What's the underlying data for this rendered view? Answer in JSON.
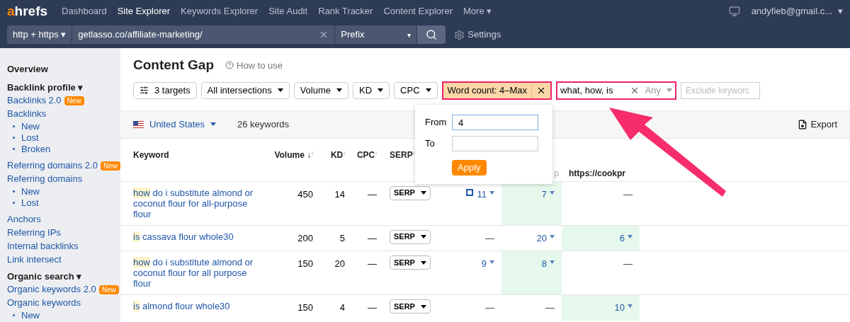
{
  "nav": {
    "logo": "ahrefs",
    "items": [
      {
        "label": "Dashboard",
        "selected": false
      },
      {
        "label": "Site Explorer",
        "selected": true
      },
      {
        "label": "Keywords Explorer",
        "selected": false
      },
      {
        "label": "Site Audit",
        "selected": false
      },
      {
        "label": "Rank Tracker",
        "selected": false
      },
      {
        "label": "Content Explorer",
        "selected": false
      },
      {
        "label": "More ▾",
        "selected": false
      }
    ],
    "account": "andyfieb@gmail.c...",
    "account_caret": "▾"
  },
  "search_bar": {
    "protocol": "http + https ▾",
    "url": "getlasso.co/affiliate-marketing/",
    "mode": "Prefix",
    "mode_caret": "▾",
    "settings": "Settings"
  },
  "sidebar": [
    {
      "kind": "heading",
      "label": "Overview"
    },
    {
      "kind": "section",
      "label": "Backlink profile ▾"
    },
    {
      "kind": "link",
      "label": "Backlinks 2.0",
      "badge": "New"
    },
    {
      "kind": "link",
      "label": "Backlinks",
      "children": [
        {
          "label": "New"
        },
        {
          "label": "Lost"
        },
        {
          "label": "Broken"
        }
      ]
    },
    {
      "kind": "link",
      "label": "Referring domains 2.0",
      "badge": "New"
    },
    {
      "kind": "link",
      "label": "Referring domains",
      "children": [
        {
          "label": "New"
        },
        {
          "label": "Lost"
        }
      ]
    },
    {
      "kind": "link",
      "label": "Anchors"
    },
    {
      "kind": "link",
      "label": "Referring IPs"
    },
    {
      "kind": "link",
      "label": "Internal backlinks"
    },
    {
      "kind": "link",
      "label": "Link intersect"
    },
    {
      "kind": "section",
      "label": "Organic search ▾"
    },
    {
      "kind": "link",
      "label": "Organic keywords 2.0",
      "badge": "New"
    },
    {
      "kind": "link",
      "label": "Organic keywords",
      "children": [
        {
          "label": "New"
        }
      ]
    }
  ],
  "page": {
    "title": "Content Gap",
    "help": "How to use"
  },
  "filters": [
    {
      "kind": "targets",
      "label": "3 targets"
    },
    {
      "kind": "dropdown",
      "label": "All intersections"
    },
    {
      "kind": "dropdown",
      "label": "Volume"
    },
    {
      "kind": "dropdown",
      "label": "KD"
    },
    {
      "kind": "dropdown",
      "label": "CPC"
    },
    {
      "kind": "active",
      "label": "Word count: 4–Max",
      "highlighted": true
    }
  ],
  "include": {
    "value": "what, how, is",
    "mode": "Any",
    "highlighted": true
  },
  "exclude": {
    "placeholder": "Exclude keyworc"
  },
  "popup": {
    "from_label": "From",
    "from_value": "4",
    "to_label": "To",
    "apply": "Apply"
  },
  "summary": {
    "country": "United States",
    "count": "26 keywords",
    "export": "Export"
  },
  "table": {
    "columns": [
      {
        "label": "Keyword"
      },
      {
        "label": "Volume ↓",
        "info": "i"
      },
      {
        "label": "KD",
        "info": "i"
      },
      {
        "label": "CPC",
        "info": "i"
      },
      {
        "label": "SERP",
        "info": "i"
      }
    ],
    "target_columns": [
      {
        "label": "p"
      },
      {
        "label": "https://cookpr"
      }
    ],
    "rows": [
      {
        "keyword_highlight": "how",
        "keyword_rest": " do i substitute almond or coconut flour for all-purpose flour",
        "volume": "450",
        "kd": "14",
        "cpc": "—",
        "serp": "SERP",
        "targets": [
          {
            "value": "11",
            "featured": true,
            "best": false,
            "arrow": true
          },
          {
            "value": "7",
            "featured": false,
            "best": true,
            "arrow": true
          },
          {
            "value": "—",
            "featured": false,
            "best": false,
            "arrow": false
          }
        ]
      },
      {
        "keyword_highlight": "is",
        "keyword_rest": " cassava flour whole30",
        "volume": "200",
        "kd": "5",
        "cpc": "—",
        "serp": "SERP",
        "targets": [
          {
            "value": "—",
            "featured": false,
            "best": false,
            "arrow": false
          },
          {
            "value": "20",
            "featured": false,
            "best": false,
            "arrow": true
          },
          {
            "value": "6",
            "featured": false,
            "best": true,
            "arrow": true
          }
        ]
      },
      {
        "keyword_highlight": "how",
        "keyword_rest": " do i substitute almond or coconut flour for all purpose flour",
        "volume": "150",
        "kd": "20",
        "cpc": "—",
        "serp": "SERP",
        "targets": [
          {
            "value": "9",
            "featured": false,
            "best": false,
            "arrow": true
          },
          {
            "value": "8",
            "featured": false,
            "best": true,
            "arrow": true
          },
          {
            "value": "—",
            "featured": false,
            "best": false,
            "arrow": false
          }
        ]
      },
      {
        "keyword_highlight": "is",
        "keyword_rest": " almond flour whole30",
        "volume": "150",
        "kd": "4",
        "cpc": "—",
        "serp": "SERP",
        "targets": [
          {
            "value": "—",
            "featured": false,
            "best": false,
            "arrow": false
          },
          {
            "value": "—",
            "featured": false,
            "best": false,
            "arrow": false
          },
          {
            "value": "10",
            "featured": false,
            "best": true,
            "arrow": true
          }
        ]
      }
    ]
  }
}
